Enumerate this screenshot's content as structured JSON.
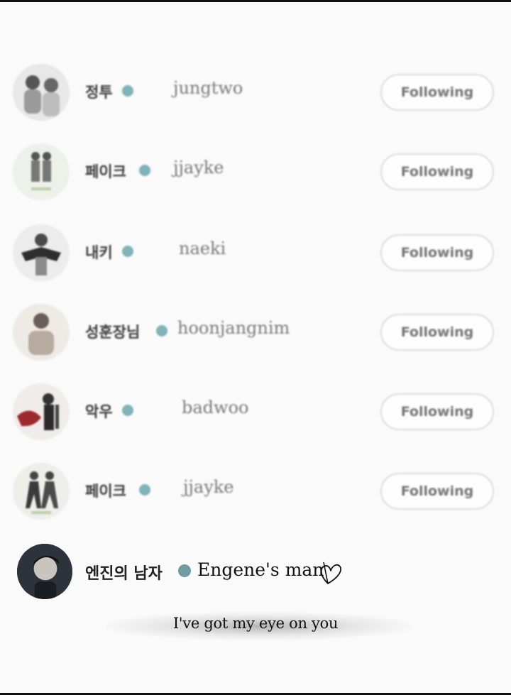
{
  "follow_list": [
    {
      "display_name": "정투",
      "handle": "jungtwo",
      "button": "Following"
    },
    {
      "display_name": "페이크",
      "handle": "jjayke",
      "button": "Following"
    },
    {
      "display_name": "내키",
      "handle": "naeki",
      "button": "Following"
    },
    {
      "display_name": "성훈장님",
      "handle": "hoonjangnim",
      "button": "Following"
    },
    {
      "display_name": "악우",
      "handle": "badwoo",
      "button": "Following"
    },
    {
      "display_name": "페이크",
      "handle": "jjayke",
      "button": "Following"
    }
  ],
  "featured": {
    "display_name": "엔진의 남자",
    "caption": "Engene's man"
  },
  "subtitle": "I've got my eye on you",
  "icons": {
    "verified": "verified-badge-icon",
    "heart": "heart-doodle-icon"
  },
  "colors": {
    "verified_badge": "#7fb3b8",
    "background": "#fafafa"
  }
}
